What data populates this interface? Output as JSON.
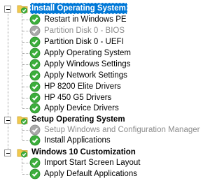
{
  "tree": {
    "groups": [
      {
        "label": "Install Operating System",
        "selected": true,
        "icon": "folder-check-icon",
        "steps": [
          {
            "label": "Restart in Windows PE",
            "enabled": true,
            "icon": "green-check-icon"
          },
          {
            "label": "Partition Disk 0 - BIOS",
            "enabled": false,
            "icon": "gray-check-icon"
          },
          {
            "label": "Partition Disk 0 - UEFI",
            "enabled": true,
            "icon": "green-check-icon"
          },
          {
            "label": "Apply Operating System",
            "enabled": true,
            "icon": "green-check-icon"
          },
          {
            "label": "Apply Windows Settings",
            "enabled": true,
            "icon": "green-check-icon"
          },
          {
            "label": "Apply Network Settings",
            "enabled": true,
            "icon": "green-check-icon"
          },
          {
            "label": "HP 8200 Elite Drivers",
            "enabled": true,
            "icon": "green-check-icon"
          },
          {
            "label": "HP 450 G5 Drivers",
            "enabled": true,
            "icon": "green-check-icon"
          },
          {
            "label": "Apply Device Drivers",
            "enabled": true,
            "icon": "green-check-icon"
          }
        ]
      },
      {
        "label": "Setup Operating System",
        "selected": false,
        "icon": "folder-check-icon",
        "steps": [
          {
            "label": "Setup Windows and Configuration Manager",
            "enabled": false,
            "icon": "gray-check-icon"
          },
          {
            "label": "Install Applications",
            "enabled": true,
            "icon": "green-check-icon"
          }
        ]
      },
      {
        "label": "Windows 10 Customization",
        "selected": false,
        "icon": "folder-check-icon",
        "steps": [
          {
            "label": "Import Start Screen Layout",
            "enabled": true,
            "icon": "green-check-icon"
          },
          {
            "label": "Apply Default Applications",
            "enabled": true,
            "icon": "green-check-icon"
          }
        ]
      }
    ]
  },
  "colors": {
    "selection": "#0078d7",
    "check_green": "#3cae3c",
    "check_gray": "#a8a8a8",
    "folder": "#f2c94c",
    "disabled_text": "#8c8c8c"
  }
}
